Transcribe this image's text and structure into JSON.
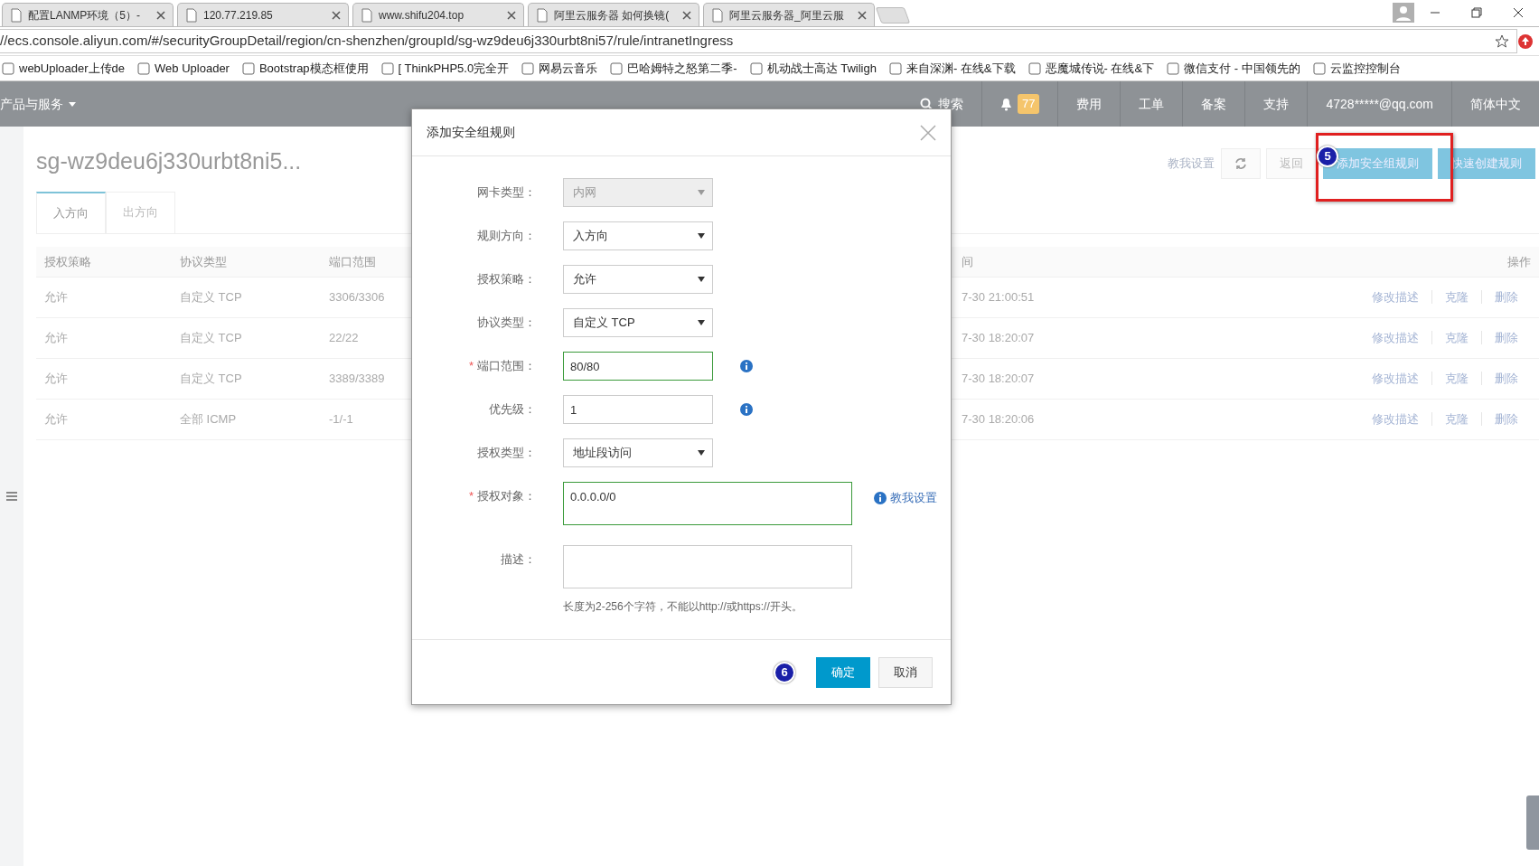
{
  "browser": {
    "tabs": [
      {
        "title": "配置LANMP环境（5）-"
      },
      {
        "title": "120.77.219.85"
      },
      {
        "title": "www.shifu204.top"
      },
      {
        "title": "阿里云服务器 如何换镜("
      },
      {
        "title": "阿里云服务器_阿里云服"
      }
    ],
    "address": "//ecs.console.aliyun.com/#/securityGroupDetail/region/cn-shenzhen/groupId/sg-wz9deu6j330urbt8ni57/rule/intranetIngress",
    "bookmarks": [
      {
        "label": "webUploader上传de"
      },
      {
        "label": "Web Uploader"
      },
      {
        "label": "Bootstrap模态框使用"
      },
      {
        "label": "[ ThinkPHP5.0完全开"
      },
      {
        "label": "网易云音乐"
      },
      {
        "label": "巴哈姆特之怒第二季-"
      },
      {
        "label": "机动战士高达 Twiligh"
      },
      {
        "label": "来自深渊- 在线&下载"
      },
      {
        "label": "恶魔城传说- 在线&下"
      },
      {
        "label": "微信支付 - 中国领先的"
      },
      {
        "label": "云监控控制台"
      }
    ]
  },
  "topnav": {
    "products_menu": "产品与服务",
    "search": "搜索",
    "notification_count": "77",
    "links": [
      "费用",
      "工单",
      "备案",
      "支持"
    ],
    "account": "4728*****@qq.com",
    "language": "简体中文"
  },
  "page": {
    "title": "sg-wz9deu6j330urbt8ni5...",
    "help_link": "教我设置",
    "back_button": "返回",
    "action_buttons": [
      "添加安全组规则",
      "快速创建规则"
    ],
    "tabs": [
      {
        "label": "入方向",
        "selected": true
      },
      {
        "label": "出方向",
        "selected": false
      }
    ],
    "table": {
      "columns": [
        "授权策略",
        "协议类型",
        "端口范围",
        "间",
        "操作"
      ],
      "rows": [
        {
          "cells": [
            "允许",
            "自定义 TCP",
            "3306/3306",
            "7-30 21:00:51"
          ],
          "actions": [
            "修改描述",
            "克隆",
            "删除"
          ]
        },
        {
          "cells": [
            "允许",
            "自定义 TCP",
            "22/22",
            "7-30 18:20:07"
          ],
          "actions": [
            "修改描述",
            "克隆",
            "删除"
          ]
        },
        {
          "cells": [
            "允许",
            "自定义 TCP",
            "3389/3389",
            "7-30 18:20:07"
          ],
          "actions": [
            "修改描述",
            "克隆",
            "删除"
          ]
        },
        {
          "cells": [
            "允许",
            "全部 ICMP",
            "-1/-1",
            "7-30 18:20:06"
          ],
          "actions": [
            "修改描述",
            "克隆",
            "删除"
          ]
        }
      ]
    }
  },
  "annotations": {
    "step_badges": [
      "5",
      "6"
    ]
  },
  "dialog": {
    "title": "添加安全组规则",
    "fields": [
      {
        "label": "网卡类型：",
        "kind": "select",
        "value": "内网",
        "disabled": true
      },
      {
        "label": "规则方向：",
        "kind": "select",
        "value": "入方向",
        "disabled": false
      },
      {
        "label": "授权策略：",
        "kind": "select",
        "value": "允许",
        "disabled": false
      },
      {
        "label": "协议类型：",
        "kind": "select",
        "value": "自定义 TCP",
        "disabled": false
      },
      {
        "label": "端口范围：",
        "required_mark": "*",
        "kind": "input",
        "value": "80/80",
        "valid": true,
        "info": true
      },
      {
        "label": "优先级：",
        "kind": "input",
        "value": "1",
        "valid": false,
        "info": true
      },
      {
        "label": "授权类型：",
        "kind": "select",
        "value": "地址段访问",
        "disabled": false
      },
      {
        "label": "授权对象：",
        "required_mark": "*",
        "kind": "textarea",
        "value": "0.0.0.0/0",
        "valid": true,
        "help_link": "教我设置"
      },
      {
        "label": "描述：",
        "kind": "textarea",
        "valid": false,
        "hint": "长度为2-256个字符，不能以http://或https://开头。"
      }
    ],
    "buttons": [
      {
        "label": "确定",
        "kind": "primary"
      },
      {
        "label": "取消",
        "kind": "secondary"
      }
    ]
  }
}
